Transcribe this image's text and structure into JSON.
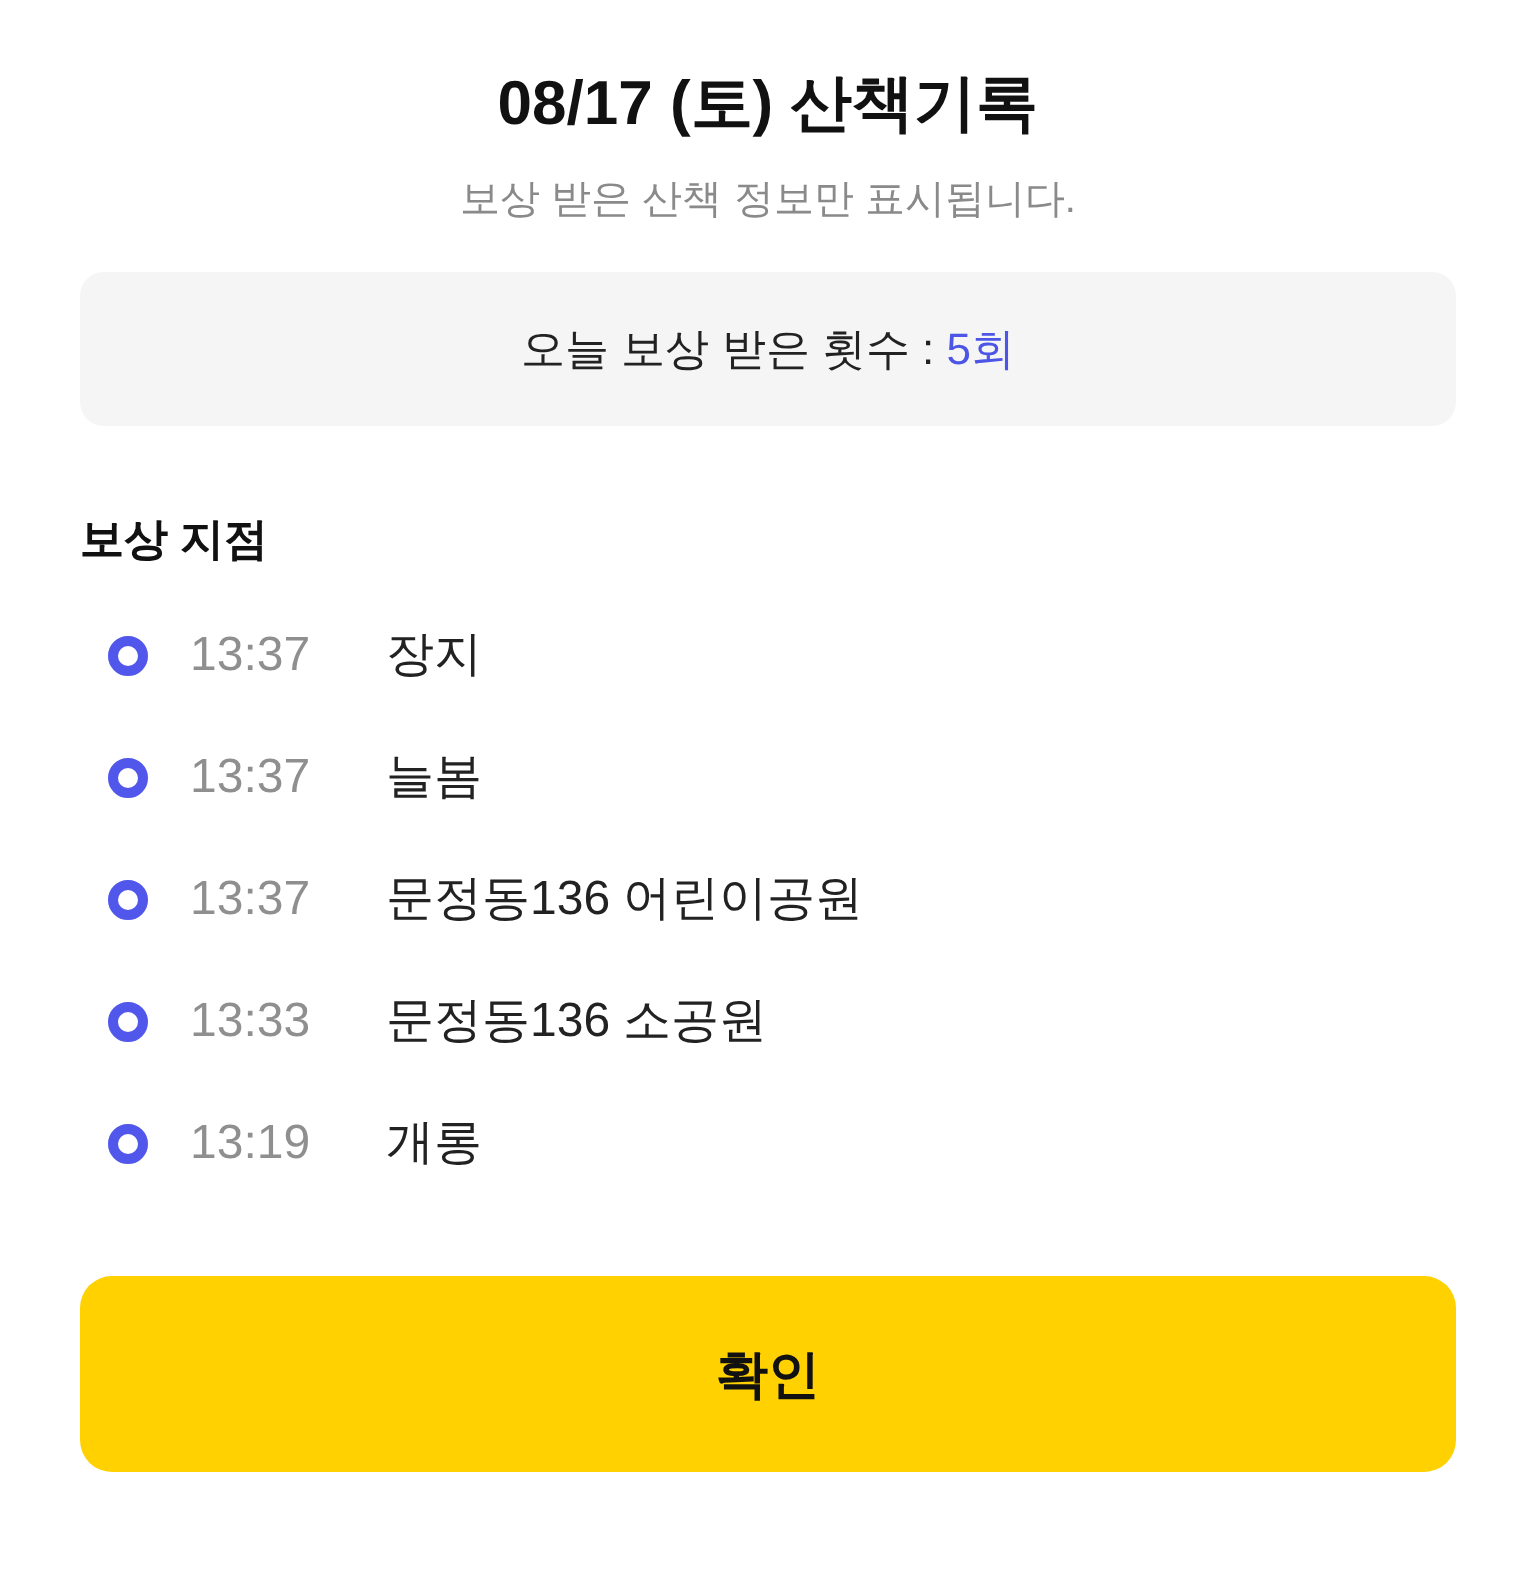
{
  "title": "08/17 (토) 산책기록",
  "subtitle": "보상 받은 산책 정보만 표시됩니다.",
  "summary": {
    "label": "오늘 보상 받은 횟수 :",
    "count": "5회"
  },
  "section_title": "보상 지점",
  "points": [
    {
      "time": "13:37",
      "name": "장지"
    },
    {
      "time": "13:37",
      "name": "늘봄"
    },
    {
      "time": "13:37",
      "name": "문정동136 어린이공원"
    },
    {
      "time": "13:33",
      "name": "문정동136 소공원"
    },
    {
      "time": "13:19",
      "name": "개롱"
    }
  ],
  "confirm_button": "확인"
}
